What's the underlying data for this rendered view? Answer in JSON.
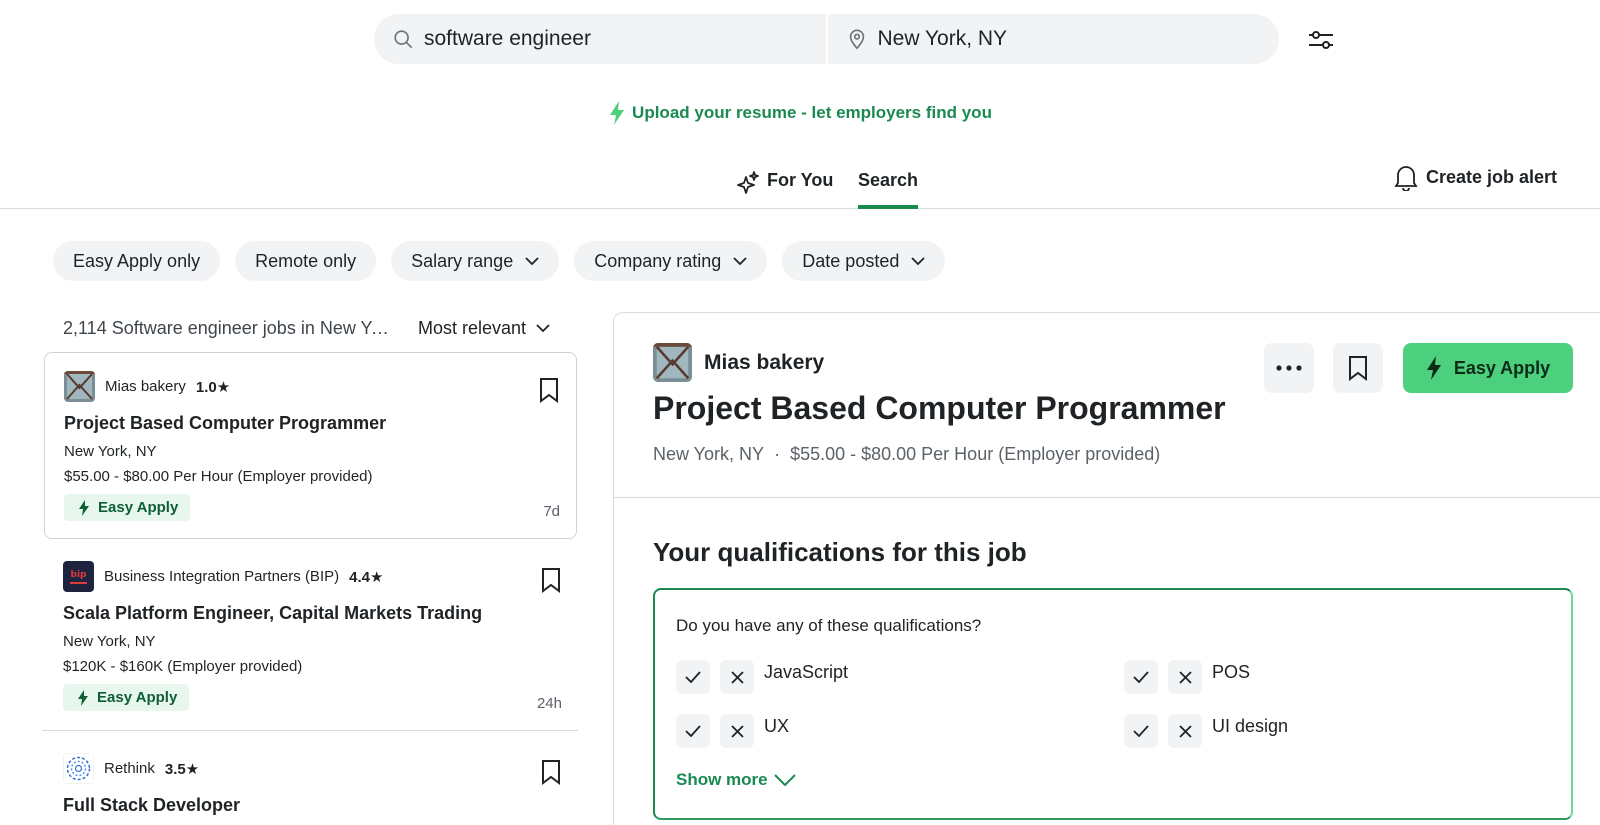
{
  "search": {
    "keyword": "software engineer",
    "location": "New York, NY"
  },
  "upload_banner": {
    "text": "Upload your resume - let employers find you"
  },
  "tabs": [
    {
      "label": "For You",
      "icon": "sparkle-icon",
      "active": false
    },
    {
      "label": "Search",
      "active": true
    }
  ],
  "alert": {
    "label": "Create job alert",
    "icon": "bell-icon"
  },
  "filters": [
    "Easy Apply only",
    "Remote only",
    "Salary range",
    "Company rating",
    "Date posted"
  ],
  "results": {
    "count_label": "2,114 Software engineer jobs in New Yor...",
    "sort_label": "Most relevant"
  },
  "jobs": [
    {
      "company": "Mias bakery",
      "rating": "1.0★",
      "title": "Project Based Computer Programmer",
      "location": "New York, NY",
      "pay": "$55.00 - $80.00 Per Hour (Employer provided)",
      "badge": "Easy Apply",
      "age": "7d"
    },
    {
      "company": "Business Integration Partners (BIP)",
      "rating": "4.4★",
      "title": "Scala Platform Engineer, Capital Markets Trading",
      "location": "New York, NY",
      "pay": "$120K - $160K (Employer provided)",
      "badge": "Easy Apply",
      "age": "24h"
    },
    {
      "company": "Rethink",
      "rating": "3.5★",
      "title": "Full Stack Developer"
    }
  ],
  "detail": {
    "company": "Mias bakery",
    "title": "Project Based Computer Programmer",
    "location": "New York, NY",
    "separator": "·",
    "pay": "$55.00 - $80.00 Per Hour (Employer provided)",
    "apply_label": "Easy Apply",
    "qualifications_title": "Your qualifications for this job",
    "qualifications_question": "Do you have any of these qualifications?",
    "qualifications": [
      "JavaScript",
      "POS",
      "UX",
      "UI design"
    ],
    "show_more": "Show more"
  },
  "colors": {
    "brand_green": "#1a8a52",
    "apply_green": "#4cd07d",
    "chip_bg": "#f2f3f4"
  }
}
